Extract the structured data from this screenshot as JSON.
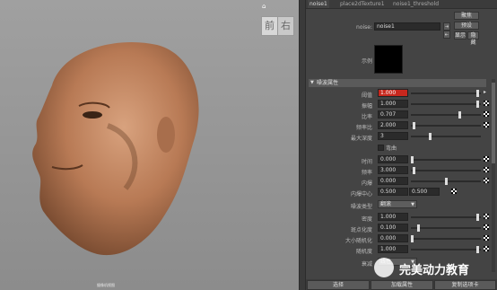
{
  "viewport": {
    "viewcube": {
      "front": "前",
      "right": "右"
    },
    "label": "摄像机视图"
  },
  "tabs": [
    "noise1",
    "place2dTexture1",
    "noise1_threshold"
  ],
  "header": {
    "node_label": "noise:",
    "node_value": "noise1",
    "focus_btn": "聚焦",
    "preset_btn": "预设",
    "show_btn": "显示",
    "hide_btn": "隐藏"
  },
  "sample_label": "示例",
  "section_title": "噪波属性",
  "attributes": [
    {
      "label": "阈值",
      "value": "1.000",
      "highlight": true
    },
    {
      "label": "振幅",
      "value": "1.000"
    },
    {
      "label": "比率",
      "value": "0.707"
    },
    {
      "label": "频率比",
      "value": "2.000"
    },
    {
      "label": "最大深度",
      "value": "3"
    }
  ],
  "inflection_label": "弯曲",
  "attributes2": [
    {
      "label": "时间",
      "value": "0.000"
    },
    {
      "label": "频率",
      "value": "3.000"
    },
    {
      "label": "内爆",
      "value": "0.000"
    }
  ],
  "implode_center": {
    "label": "内爆中心",
    "x": "0.500",
    "y": "0.500"
  },
  "noise_type": {
    "label": "噪波类型",
    "value": "翻滚"
  },
  "attributes3": [
    {
      "label": "密度",
      "value": "1.000"
    },
    {
      "label": "斑点化度",
      "value": "0.100"
    },
    {
      "label": "大小随机化",
      "value": "0.000"
    },
    {
      "label": "随机度",
      "value": "1.000"
    }
  ],
  "falloff": {
    "label": "衰减",
    "value": "线性"
  },
  "bottom": {
    "select": "选择",
    "load": "加载属性",
    "copy": "复制选项卡"
  },
  "watermark": "完美动力教育",
  "colors": {
    "accent": "#c8281e",
    "panel": "#444444"
  }
}
